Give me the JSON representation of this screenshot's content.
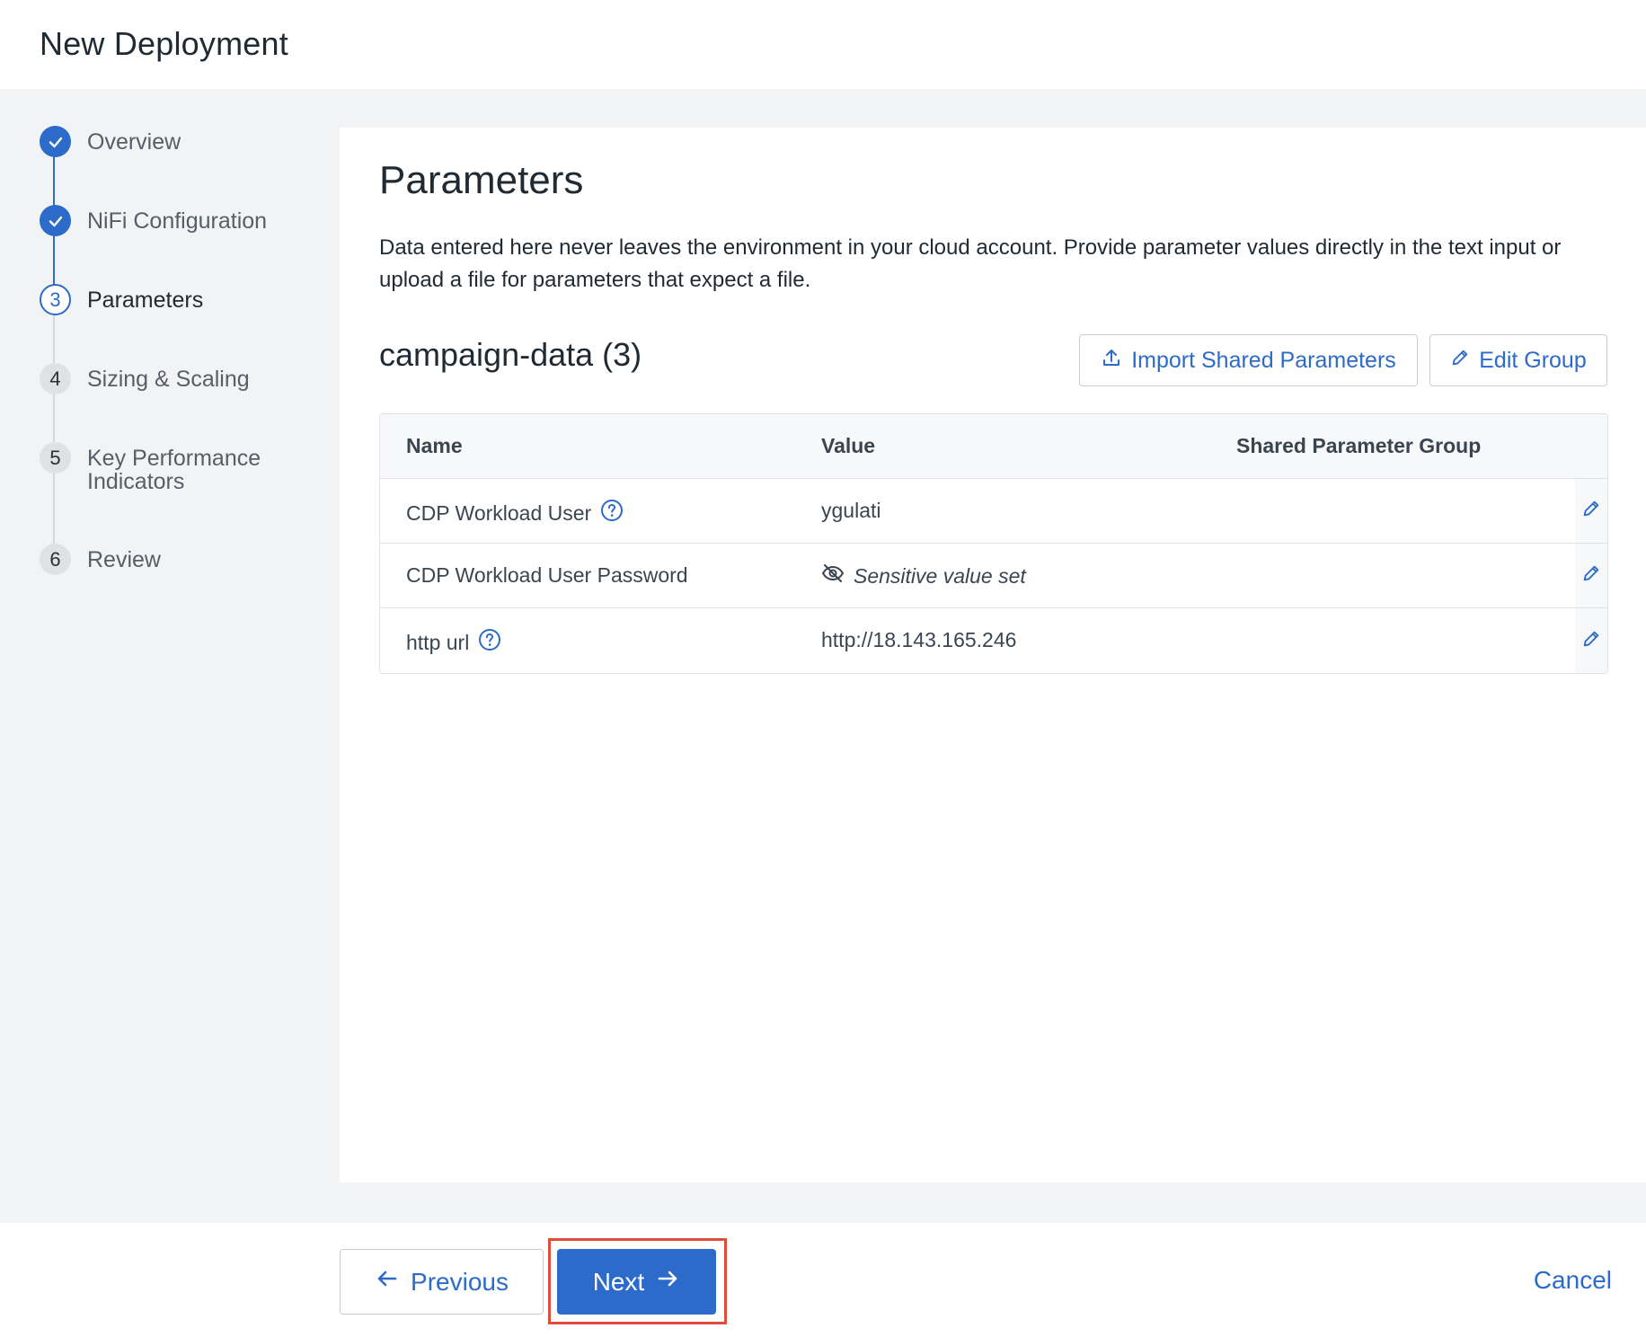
{
  "header": {
    "title": "New Deployment"
  },
  "stepper": {
    "steps": [
      {
        "label": "Overview",
        "state": "done",
        "number": ""
      },
      {
        "label": "NiFi Configuration",
        "state": "done",
        "number": ""
      },
      {
        "label": "Parameters",
        "state": "current",
        "number": "3"
      },
      {
        "label": "Sizing & Scaling",
        "state": "todo",
        "number": "4"
      },
      {
        "label_line1": "Key Performance",
        "label_line2": "Indicators",
        "state": "todo",
        "number": "5"
      },
      {
        "label": "Review",
        "state": "todo",
        "number": "6"
      }
    ]
  },
  "main": {
    "title": "Parameters",
    "description": "Data entered here never leaves the environment in your cloud account. Provide parameter values directly in the text input or upload a file for parameters that expect a file.",
    "group_title": "campaign-data (3)",
    "import_button": "Import Shared Parameters",
    "edit_group_button": "Edit Group",
    "table": {
      "headers": [
        "Name",
        "Value",
        "Shared Parameter Group"
      ],
      "rows": [
        {
          "name": "CDP Workload User",
          "value": "ygulati",
          "group": ""
        },
        {
          "name": "CDP Workload User Password",
          "value": "Sensitive value set",
          "group": ""
        },
        {
          "name": "http url",
          "value": "http://18.143.165.246",
          "group": ""
        }
      ]
    }
  },
  "footer": {
    "previous_label": "Previous",
    "next_label": "Next",
    "cancel_label": "Cancel"
  },
  "colors": {
    "accent": "#2c6bc9",
    "highlight": "#e24d3b",
    "page_bg": "#f2f3f5"
  },
  "icons": {
    "check": "check-icon",
    "help": "help-circle-icon",
    "edit": "pencil-icon",
    "upload": "upload-icon",
    "hidden": "eye-off-icon",
    "arrow_left": "arrow-left-icon",
    "arrow_right": "arrow-right-icon"
  }
}
